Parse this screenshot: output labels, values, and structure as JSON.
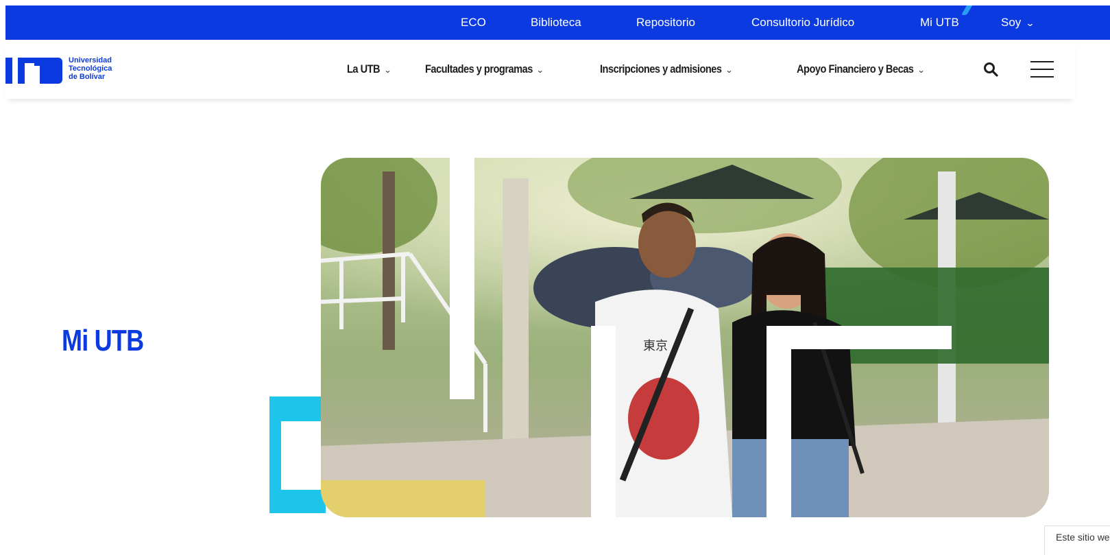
{
  "topbar": {
    "links": [
      "ECO",
      "Biblioteca",
      "Repositorio",
      "Consultorio Jurídico",
      "Mi UTB",
      "Soy"
    ],
    "soy_chevron": "⌄"
  },
  "logo": {
    "line1": "Universidad",
    "line2": "Tecnológica",
    "line3": "de Bolívar"
  },
  "nav": {
    "items": [
      "La UTB",
      "Facultades y programas",
      "Inscripciones y admisiones",
      "Apoyo Financiero y Becas"
    ]
  },
  "hero": {
    "title": "Mi UTB",
    "photo_text": "東京"
  },
  "cookie_banner": {
    "text": "Este sitio web usa"
  },
  "colors": {
    "brand_blue": "#0b3ae0",
    "accent_cyan": "#1ec5ea"
  }
}
